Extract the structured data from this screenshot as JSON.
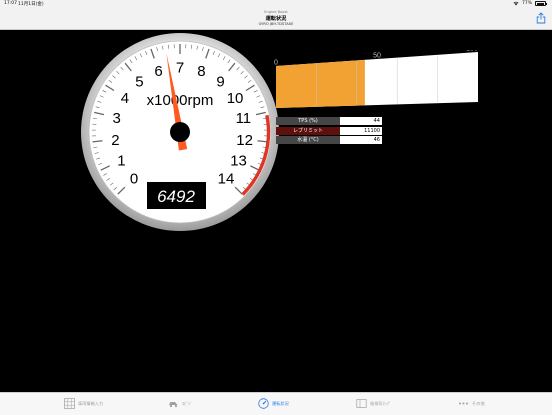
{
  "status_bar": {
    "time": "17:07",
    "date": "11月1日(金)",
    "battery": "77%"
  },
  "nav": {
    "pretitle": "Engine Boost",
    "title": "運転状況",
    "subtitle": "GYRO JBH-TDSTAXE"
  },
  "gauge": {
    "unit_label": "x1000rpm",
    "ticks": [
      "0",
      "1",
      "2",
      "3",
      "4",
      "5",
      "6",
      "7",
      "8",
      "9",
      "10",
      "11",
      "12",
      "13",
      "14"
    ],
    "max": 14,
    "redline_start": 11.1,
    "needle_value": 6.492,
    "digital_readout": "6492",
    "colors": {
      "redline": "#e53322",
      "needle": "#ff5a1f"
    }
  },
  "bar_meter": {
    "labels": [
      "0",
      "50",
      "100"
    ],
    "value_percent": 44,
    "color": "#f2a233"
  },
  "data_table": {
    "rows": [
      {
        "label": "TPS (%)",
        "value": "44"
      },
      {
        "label": "レブリミット",
        "value": "11100"
      },
      {
        "label": "水温 (°C)",
        "value": "46"
      }
    ]
  },
  "tabs": [
    {
      "label": "車両情報入力",
      "icon": "grid-icon"
    },
    {
      "label": "ｽﾋﾟﾄﾞ",
      "icon": "car-icon"
    },
    {
      "label": "運転状況",
      "icon": "gauge-icon",
      "active": true
    },
    {
      "label": "吸排気ﾏｯﾌﾟ",
      "icon": "map-icon"
    },
    {
      "label": "その他",
      "icon": "more-icon"
    }
  ]
}
